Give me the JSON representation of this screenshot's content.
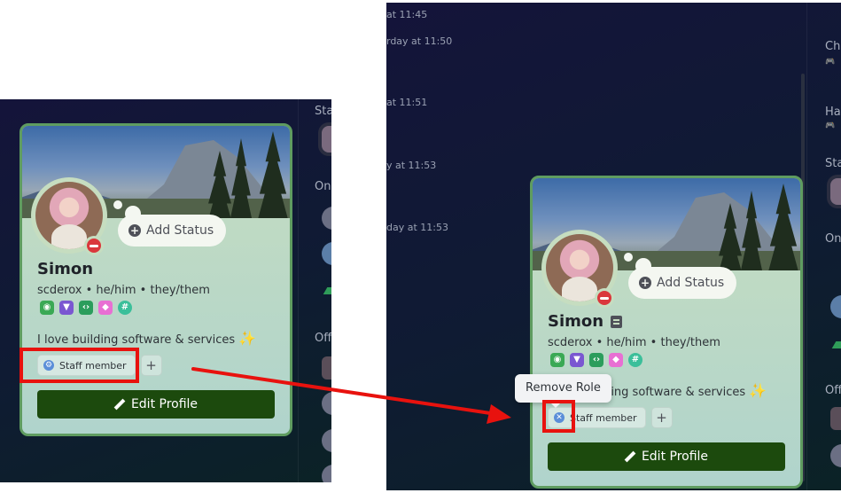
{
  "left": {
    "side_labels": [
      "Sta",
      "Onl",
      "Off"
    ],
    "profile": {
      "add_status": "Add Status",
      "name": "Simon",
      "handle": "scderox",
      "pronouns": "he/him • they/them",
      "bio": "I love building software & services",
      "role": "Staff member",
      "edit_button": "Edit Profile"
    }
  },
  "right": {
    "timestamps": [
      "at 11:45",
      "rday at 11:50",
      "at 11:51",
      "y at 11:53",
      "day at 11:53"
    ],
    "side_labels": [
      "Ch",
      "Ha",
      "Sta",
      "On",
      "Off"
    ],
    "tooltip": "Remove Role",
    "profile": {
      "add_status": "Add Status",
      "name": "Simon",
      "handle": "scderox",
      "pronouns": "he/him • they/them",
      "bio": "I love building software & services",
      "role": "Staff member",
      "edit_button": "Edit Profile"
    }
  },
  "badge_colors": [
    "#3aa955",
    "#7a57d1",
    "#2b9d5c",
    "#e86fd3",
    "#3bbf9a"
  ],
  "highlight_color": "#e8120e"
}
